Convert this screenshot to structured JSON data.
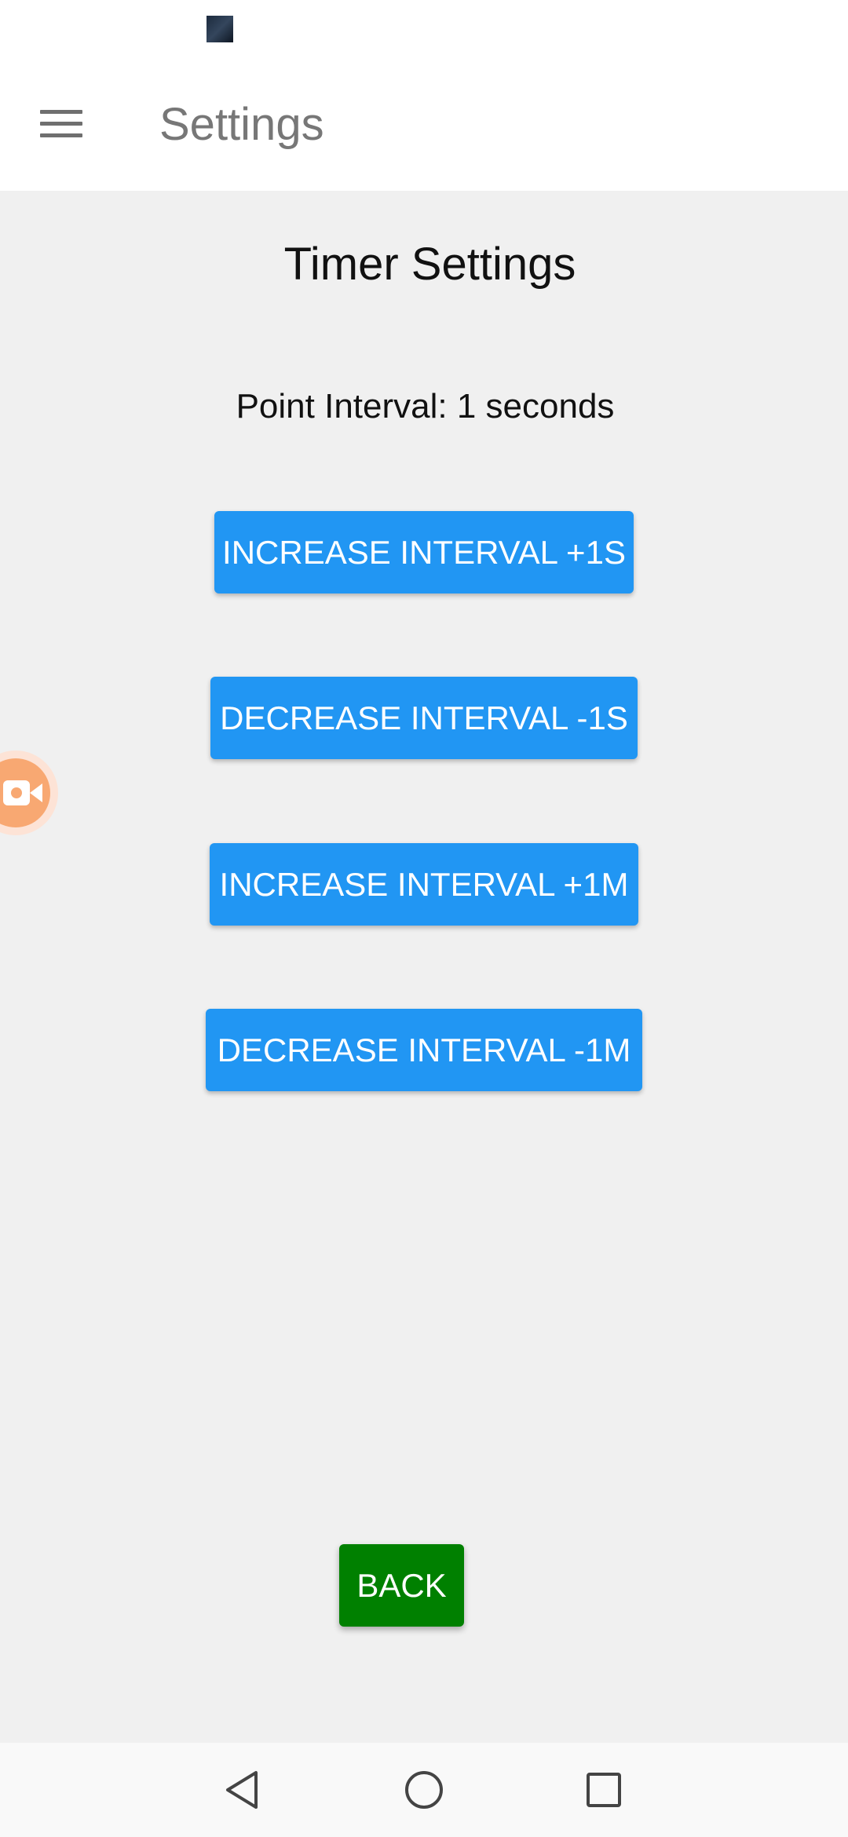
{
  "app_bar": {
    "title": "Settings",
    "menu_icon": "hamburger-menu-icon"
  },
  "main": {
    "heading": "Timer Settings",
    "interval_label": "Point Interval: 1 seconds",
    "buttons": [
      {
        "label": "INCREASE INTERVAL +1S"
      },
      {
        "label": "DECREASE INTERVAL -1S"
      },
      {
        "label": "INCREASE INTERVAL +1M"
      },
      {
        "label": "DECREASE INTERVAL -1M"
      }
    ],
    "back_label": "BACK"
  },
  "colors": {
    "action_button": "#2196f3",
    "back_button": "#008000",
    "background": "#f0f0f0",
    "recorder_bubble": "#f8a872"
  },
  "icons": {
    "floating": "video-camera-icon",
    "nav": [
      "triangle-back-icon",
      "circle-home-icon",
      "square-recents-icon"
    ]
  }
}
